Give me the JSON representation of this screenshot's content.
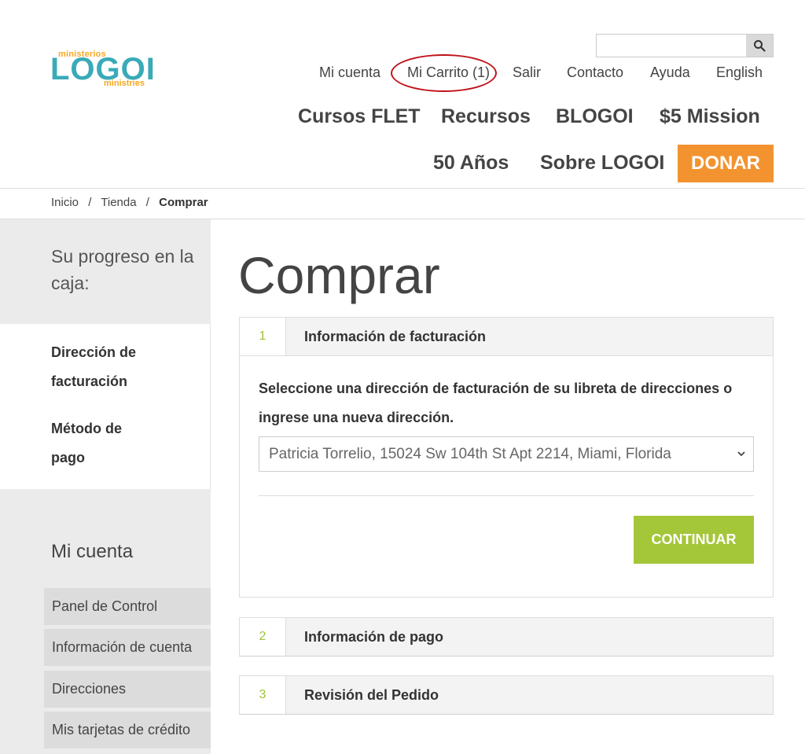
{
  "header": {
    "logo": {
      "top": "ministerios",
      "main": "LOGOI",
      "bottom": "ministries"
    },
    "search": {
      "placeholder": ""
    },
    "top_nav": [
      "Mi cuenta",
      "Mi Carrito (1)",
      "Salir",
      "Contacto",
      "Ayuda",
      "English"
    ],
    "main_nav": [
      "Cursos FLET",
      "Recursos",
      "BLOGOI",
      "$5 Mission",
      "50 Años",
      "Sobre LOGOI"
    ],
    "donate": "DONAR",
    "colors": {
      "donate": "#f2932f",
      "cart_highlight": "#c0121a",
      "accent_green": "#a4c639"
    }
  },
  "breadcrumb": {
    "home": "Inicio",
    "store": "Tienda",
    "current": "Comprar",
    "separator": "/"
  },
  "sidebar": {
    "progress_title": "Su progreso en la caja:",
    "steps": [
      "Dirección de facturación",
      "Método de pago"
    ],
    "account_title": "Mi cuenta",
    "account_links": [
      "Panel de Control",
      "Información de cuenta",
      "Direcciones",
      "Mis tarjetas de crédito"
    ]
  },
  "main": {
    "title": "Comprar",
    "sections": [
      {
        "number": "1",
        "label": "Información de facturación"
      },
      {
        "number": "2",
        "label": "Información de pago"
      },
      {
        "number": "3",
        "label": "Revisión del Pedido"
      }
    ],
    "billing": {
      "instructions": "Seleccione una dirección de facturación de su libreta de direcciones o ingrese una nueva dirección.",
      "selected_address": "Patricia Torrelio, 15024 Sw 104th St Apt 2214, Miami, Florida",
      "continue_label": "CONTINUAR"
    }
  }
}
